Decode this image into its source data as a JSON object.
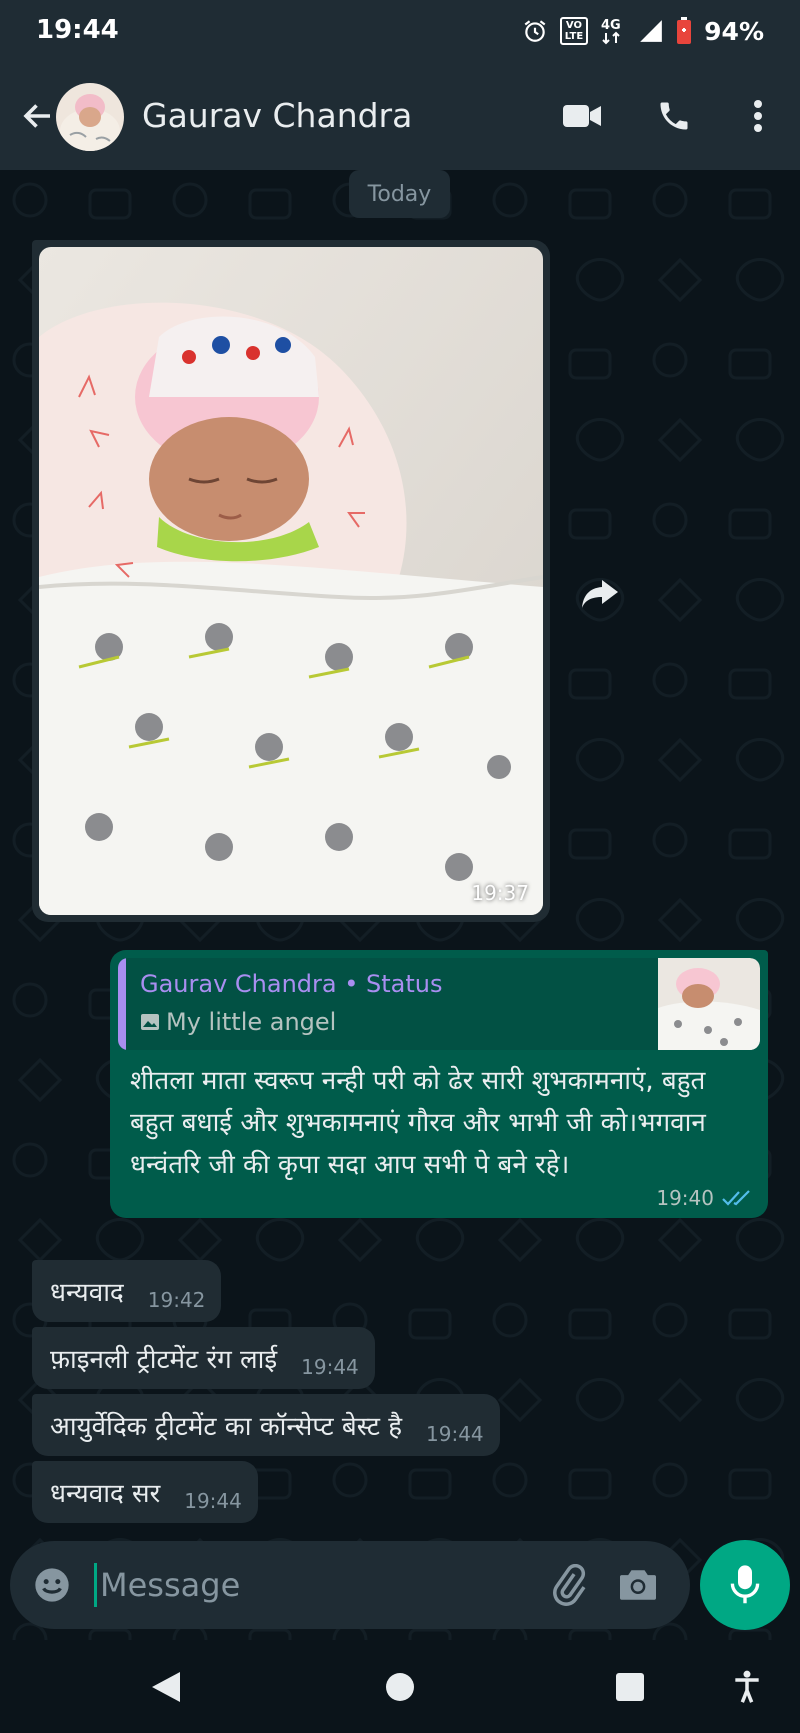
{
  "status_bar": {
    "time": "19:44",
    "volte": "VO\nLTE",
    "network": "4G",
    "battery": "94%"
  },
  "header": {
    "contact_name": "Gaurav Chandra"
  },
  "chat": {
    "date_chip": "Today",
    "image_message": {
      "time": "19:37"
    },
    "reply_message": {
      "quote_title": "Gaurav Chandra • Status",
      "quote_subtitle": "My little angel",
      "text": "शीतला माता स्वरूप नन्ही परी को ढेर सारी शुभकामनाएं, बहुत बहुत बधाई और शुभकामनाएं गौरव और भाभी जी को।भगवान धन्वंतरि जी की कृपा सदा आप सभी पे बने रहे।",
      "time": "19:40",
      "status": "read"
    },
    "incoming": [
      {
        "text": "धन्यवाद",
        "time": "19:42"
      },
      {
        "text": "फ़ाइनली ट्रीटमेंट रंग लाई",
        "time": "19:44"
      },
      {
        "text": "आयुर्वेदिक ट्रीटमेंट का कॉन्सेप्ट बेस्ट है",
        "time": "19:44"
      },
      {
        "text": "धन्यवाद सर",
        "time": "19:44"
      }
    ]
  },
  "composer": {
    "placeholder": "Message"
  },
  "colors": {
    "header_bg": "#1f2c34",
    "chat_bg": "#0b141a",
    "incoming_bubble": "#202c33",
    "outgoing_bubble": "#005c4b",
    "accent": "#00a884",
    "quote_name": "#a98ef0",
    "read_ticks": "#53bdeb"
  },
  "icons": {
    "back": "arrow-left-icon",
    "video": "video-camera-icon",
    "call": "phone-icon",
    "menu": "more-vertical-icon",
    "forward": "forward-icon",
    "emoji": "emoji-icon",
    "attach": "paperclip-icon",
    "camera": "camera-icon",
    "mic": "microphone-icon"
  }
}
